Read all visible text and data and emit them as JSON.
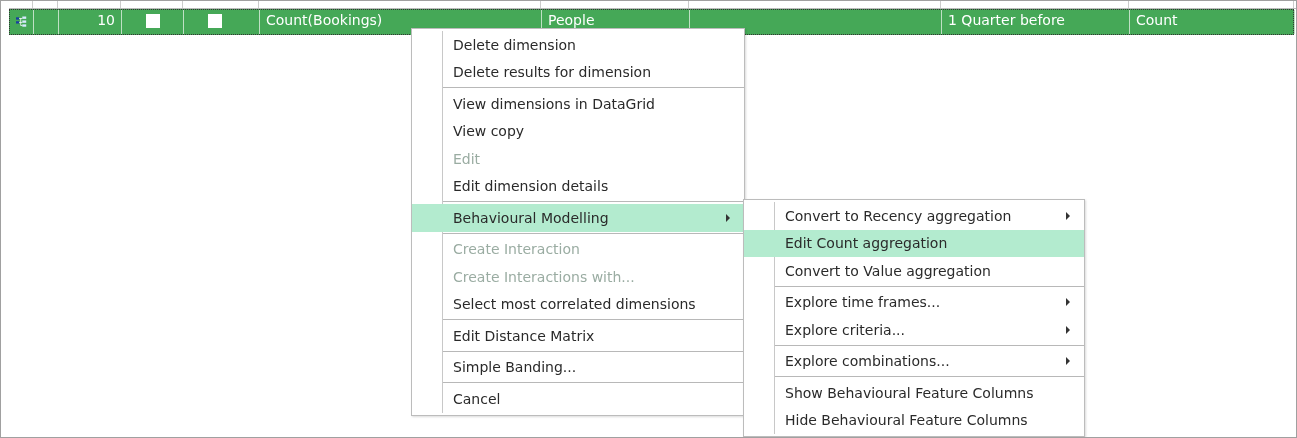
{
  "grid": {
    "row": {
      "selected": true,
      "cells": [
        {
          "kind": "icon"
        },
        {
          "kind": "blank"
        },
        {
          "kind": "number",
          "text": "10"
        },
        {
          "kind": "checkbox",
          "checked": false
        },
        {
          "kind": "checkbox",
          "checked": false
        },
        {
          "kind": "text",
          "text": "Count(Bookings)"
        },
        {
          "kind": "text",
          "text": "People"
        },
        {
          "kind": "blank"
        },
        {
          "kind": "text",
          "text": "1 Quarter before"
        },
        {
          "kind": "text",
          "text": "Count"
        }
      ]
    }
  },
  "context_menu": {
    "items": [
      {
        "kind": "item",
        "label": "Delete dimension",
        "disabled": false,
        "highlighted": false,
        "submenu": false
      },
      {
        "kind": "item",
        "label": "Delete results for dimension",
        "disabled": false,
        "highlighted": false,
        "submenu": false
      },
      {
        "kind": "separator"
      },
      {
        "kind": "item",
        "label": "View dimensions in DataGrid",
        "disabled": false,
        "highlighted": false,
        "submenu": false
      },
      {
        "kind": "item",
        "label": "View copy",
        "disabled": false,
        "highlighted": false,
        "submenu": false
      },
      {
        "kind": "item",
        "label": "Edit",
        "disabled": true,
        "highlighted": false,
        "submenu": false
      },
      {
        "kind": "item",
        "label": "Edit dimension details",
        "disabled": false,
        "highlighted": false,
        "submenu": false
      },
      {
        "kind": "separator"
      },
      {
        "kind": "item",
        "label": "Behavioural Modelling",
        "disabled": false,
        "highlighted": true,
        "submenu": true
      },
      {
        "kind": "separator"
      },
      {
        "kind": "item",
        "label": "Create Interaction",
        "disabled": true,
        "highlighted": false,
        "submenu": false
      },
      {
        "kind": "item",
        "label": "Create Interactions with...",
        "disabled": true,
        "highlighted": false,
        "submenu": false
      },
      {
        "kind": "item",
        "label": "Select most correlated dimensions",
        "disabled": false,
        "highlighted": false,
        "submenu": false
      },
      {
        "kind": "separator"
      },
      {
        "kind": "item",
        "label": "Edit Distance Matrix",
        "disabled": false,
        "highlighted": false,
        "submenu": false
      },
      {
        "kind": "separator"
      },
      {
        "kind": "item",
        "label": "Simple Banding...",
        "disabled": false,
        "highlighted": false,
        "submenu": false
      },
      {
        "kind": "separator"
      },
      {
        "kind": "item",
        "label": "Cancel",
        "disabled": false,
        "highlighted": false,
        "submenu": false
      }
    ]
  },
  "submenu": {
    "items": [
      {
        "kind": "item",
        "label": "Convert to Recency aggregation",
        "disabled": false,
        "highlighted": false,
        "submenu": true
      },
      {
        "kind": "item",
        "label": "Edit Count aggregation",
        "disabled": false,
        "highlighted": true,
        "submenu": false
      },
      {
        "kind": "item",
        "label": "Convert to Value aggregation",
        "disabled": false,
        "highlighted": false,
        "submenu": false
      },
      {
        "kind": "separator"
      },
      {
        "kind": "item",
        "label": "Explore time frames...",
        "disabled": false,
        "highlighted": false,
        "submenu": true
      },
      {
        "kind": "item",
        "label": "Explore criteria...",
        "disabled": false,
        "highlighted": false,
        "submenu": true
      },
      {
        "kind": "separator"
      },
      {
        "kind": "item",
        "label": "Explore combinations...",
        "disabled": false,
        "highlighted": false,
        "submenu": true
      },
      {
        "kind": "separator"
      },
      {
        "kind": "item",
        "label": "Show Behavioural Feature Columns",
        "disabled": false,
        "highlighted": false,
        "submenu": false
      },
      {
        "kind": "item",
        "label": "Hide Behavioural Feature Columns",
        "disabled": false,
        "highlighted": false,
        "submenu": false
      }
    ]
  }
}
